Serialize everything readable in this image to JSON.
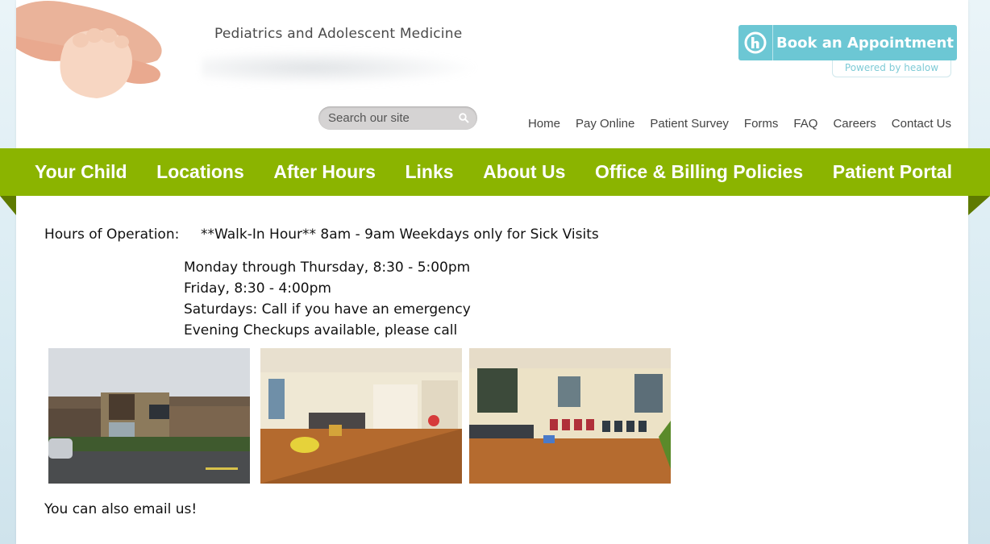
{
  "header": {
    "site_title": "Pediatrics and Adolescent Medicine",
    "book_button": "Book an Appointment",
    "powered_by": "Powered by healow"
  },
  "search": {
    "placeholder": "Search our site"
  },
  "top_links": [
    "Home",
    "Pay Online",
    "Patient Survey",
    "Forms",
    "FAQ",
    "Careers",
    "Contact Us"
  ],
  "nav": [
    "Your Child",
    "Locations",
    "After Hours",
    "Links",
    "About Us",
    "Office & Billing Policies",
    "Patient Portal"
  ],
  "content": {
    "hours_label": "Hours of Operation:",
    "walk_in": "**Walk-In Hour** 8am - 9am Weekdays only for Sick Visits",
    "hours": [
      "Monday through Thursday, 8:30 - 5:00pm",
      "Friday, 8:30 - 4:00pm",
      "Saturdays:  Call if you have an emergency",
      "Evening Checkups available, please call"
    ],
    "email_note": "You can also email us!"
  },
  "colors": {
    "nav_green": "#8bb400",
    "book_teal": "#6cc7d4"
  }
}
